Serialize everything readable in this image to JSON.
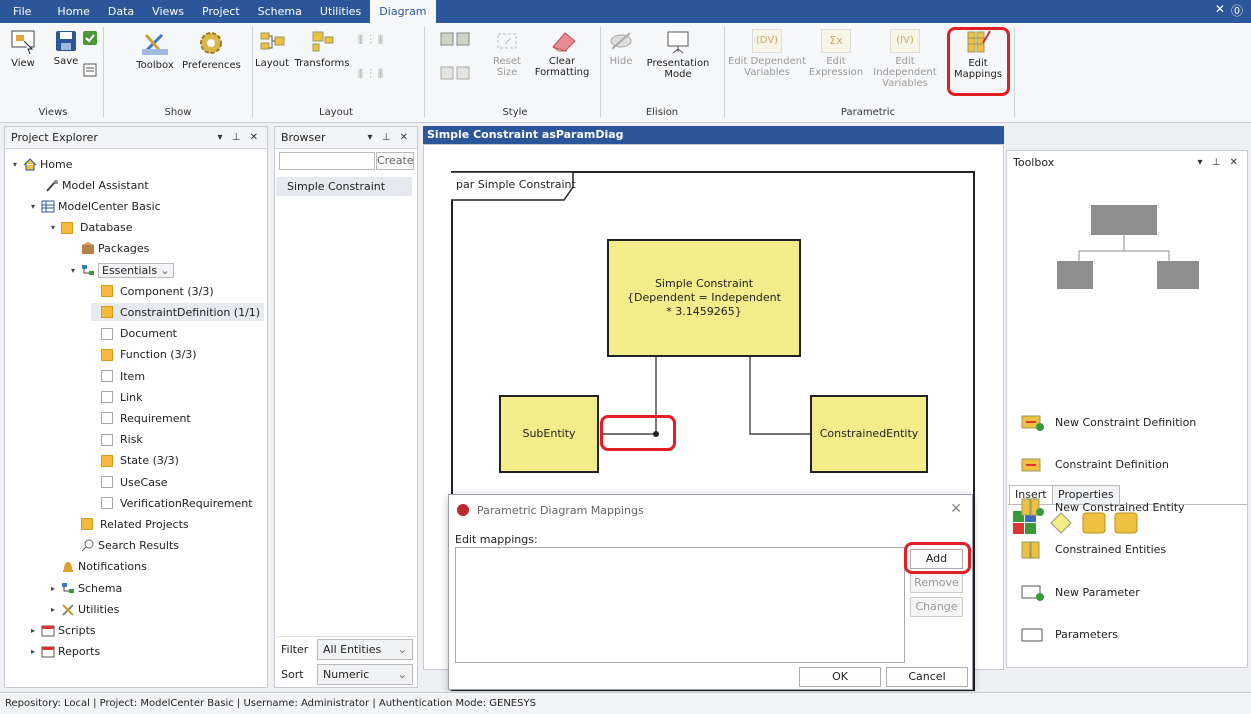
{
  "menu": {
    "tabs": [
      "File",
      "Home",
      "Data",
      "Views",
      "Project",
      "Schema",
      "Utilities",
      "Diagram"
    ],
    "active": "Diagram"
  },
  "ribbon": {
    "view": "View",
    "save": "Save",
    "views_group": "Views",
    "toolbox": "Toolbox",
    "preferences": "Preferences",
    "show_group": "Show",
    "layout": "Layout",
    "transforms": "Transforms",
    "layout_group": "Layout",
    "reset_size": "Reset Size",
    "clear_formatting": "Clear Formatting",
    "style_group": "Style",
    "hide": "Hide",
    "presentation_mode": "Presentation Mode",
    "elision_group": "Elision",
    "edit_dependent": "Edit Dependent Variables",
    "edit_expression": "Edit Expression",
    "edit_independent": "Edit Independent Variables",
    "edit_mappings": "Edit Mappings",
    "parametric_group": "Parametric",
    "dv": "(DV)",
    "sigma": "Σx",
    "iv": "(IV)"
  },
  "project_explorer": {
    "title": "Project Explorer",
    "items": [
      {
        "label": "Home"
      },
      {
        "label": "Model Assistant"
      },
      {
        "label": "ModelCenter Basic"
      },
      {
        "label": "Database"
      },
      {
        "label": "Packages"
      },
      {
        "label": "Essentials"
      },
      {
        "label": "Component  (3/3)"
      },
      {
        "label": "ConstraintDefinition  (1/1)"
      },
      {
        "label": "Document"
      },
      {
        "label": "Function  (3/3)"
      },
      {
        "label": "Item"
      },
      {
        "label": "Link"
      },
      {
        "label": "Requirement"
      },
      {
        "label": "Risk"
      },
      {
        "label": "State  (3/3)"
      },
      {
        "label": "UseCase"
      },
      {
        "label": "VerificationRequirement"
      },
      {
        "label": "Related Projects"
      },
      {
        "label": "Search Results"
      },
      {
        "label": "Notifications"
      },
      {
        "label": "Schema"
      },
      {
        "label": "Utilities"
      },
      {
        "label": "Scripts"
      },
      {
        "label": "Reports"
      }
    ]
  },
  "browser": {
    "title": "Browser",
    "create": "Create",
    "item": "Simple Constraint",
    "filter_label": "Filter",
    "filter_value": "All Entities",
    "sort_label": "Sort",
    "sort_value": "Numeric"
  },
  "diagram": {
    "tab": "Simple Constraint asParamDiag",
    "frame_label": "par Simple Constraint",
    "constraint": "Simple Constraint\n{Dependent = Independent\n* 3.1459265}",
    "sub": "SubEntity",
    "constrained": "ConstrainedEntity"
  },
  "toolbox": {
    "title": "Toolbox",
    "tab_insert": "Insert",
    "tab_properties": "Properties",
    "items": [
      "New Constraint Definition",
      "Constraint Definition",
      "New Constrained Entity",
      "Constrained Entities",
      "New Parameter",
      "Parameters"
    ]
  },
  "dialog": {
    "title": "Parametric Diagram Mappings",
    "edit_label": "Edit mappings:",
    "add": "Add",
    "remove": "Remove",
    "change": "Change",
    "ok": "OK",
    "cancel": "Cancel"
  },
  "status": "Repository: Local  |  Project: ModelCenter Basic  |  Username: Administrator  |  Authentication Mode: GENESYS",
  "colors": {
    "menubar": "#2b579a",
    "block": "#f3ec8b",
    "highlight": "#e41e25"
  }
}
